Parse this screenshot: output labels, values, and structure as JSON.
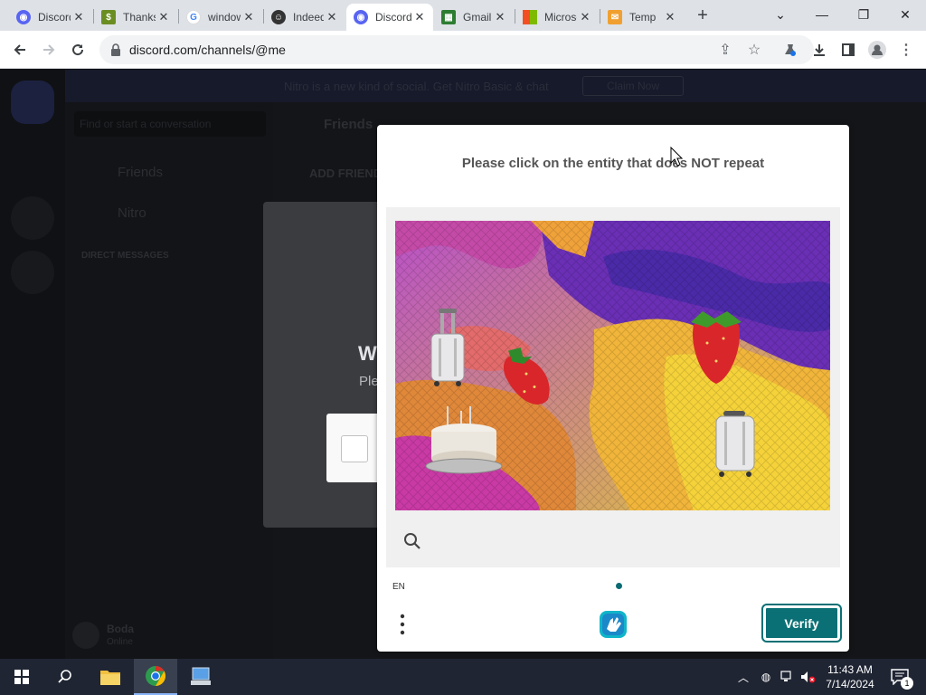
{
  "browser": {
    "tabs": [
      {
        "title": "Discord",
        "favicon": "discord-icon",
        "color": "#5865f2"
      },
      {
        "title": "Thanks",
        "favicon": "money-icon",
        "color": "#6b8e23"
      },
      {
        "title": "windows",
        "favicon": "google-icon",
        "color": "#4285f4"
      },
      {
        "title": "Indeed",
        "favicon": "character-icon",
        "color": "#333333"
      },
      {
        "title": "Discord",
        "favicon": "discord-icon",
        "color": "#5865f2",
        "active": true
      },
      {
        "title": "Gmail",
        "favicon": "game-icon",
        "color": "#2e7d32"
      },
      {
        "title": "Microsoft",
        "favicon": "microsoft-icon",
        "color": "#f25022"
      },
      {
        "title": "Temp",
        "favicon": "mail-icon",
        "color": "#f0a030"
      }
    ],
    "new_tab_label": "+",
    "url": "discord.com/channels/@me"
  },
  "discord": {
    "banner": "Nitro is a new kind of social. Get Nitro Basic & chat",
    "banner_button": "Claim Now",
    "search_placeholder": "Find or start a conversation",
    "friends_label": "Friends",
    "nitro_label": "Nitro",
    "direct_messages_label": "DIRECT MESSAGES",
    "header_friends": "Friends",
    "add_friend_label": "ADD FRIEND",
    "user_name": "Boda",
    "user_status": "Online",
    "welcome_title": "W",
    "welcome_text": "Ple"
  },
  "captcha": {
    "prompt": "Please click on the entity that does NOT repeat",
    "language": "EN",
    "verify_label": "Verify",
    "accent_color": "#0a7075",
    "challenge_objects": [
      "suitcase",
      "strawberry",
      "strawberry",
      "birthday-cake",
      "suitcase"
    ]
  },
  "taskbar": {
    "time": "11:43 AM",
    "date": "7/14/2024",
    "notification_count": "1"
  }
}
